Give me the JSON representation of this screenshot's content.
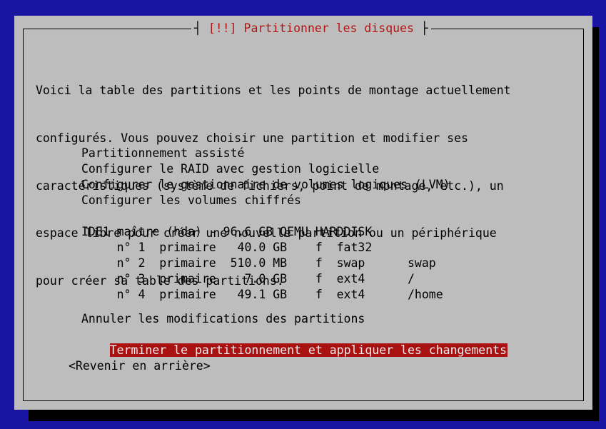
{
  "dialog": {
    "title": "[!!] Partitionner les disques",
    "title_left_bar": "┤ ",
    "title_right_bar": " ├"
  },
  "intro_lines": [
    "Voici la table des partitions et les points de montage actuellement",
    "configurés. Vous pouvez choisir une partition et modifier ses",
    "caractéristiques (système de fichiers, point de montage, etc.), un",
    "espace libre pour créer une nouvelle partition ou un périphérique",
    "pour créer sa table des partitions."
  ],
  "menu": {
    "guided": "Partitionnement assisté",
    "raid": "Configurer le RAID avec gestion logicielle",
    "lvm": "Configurer le gestionnaire de volumes logiques (LVM)",
    "crypto": "Configurer les volumes chiffrés",
    "disk": "IDE1 maître (hda) - 96.6 GB QEMU HARDDISK",
    "partitions": [
      "     n° 1  primaire   40.0 GB    f  fat32",
      "     n° 2  primaire  510.0 MB    f  swap      swap",
      "     n° 3  primaire    7.0 GB    f  ext4      /",
      "     n° 4  primaire   49.1 GB    f  ext4      /home"
    ],
    "undo": "Annuler les modifications des partitions",
    "finish": "Terminer le partitionnement et appliquer les changements"
  },
  "back_button": "<Revenir en arrière>",
  "colors": {
    "background": "#1a14a3",
    "dialog": "#bdbdbd",
    "title": "#b21515",
    "selection": "#aa1212"
  }
}
